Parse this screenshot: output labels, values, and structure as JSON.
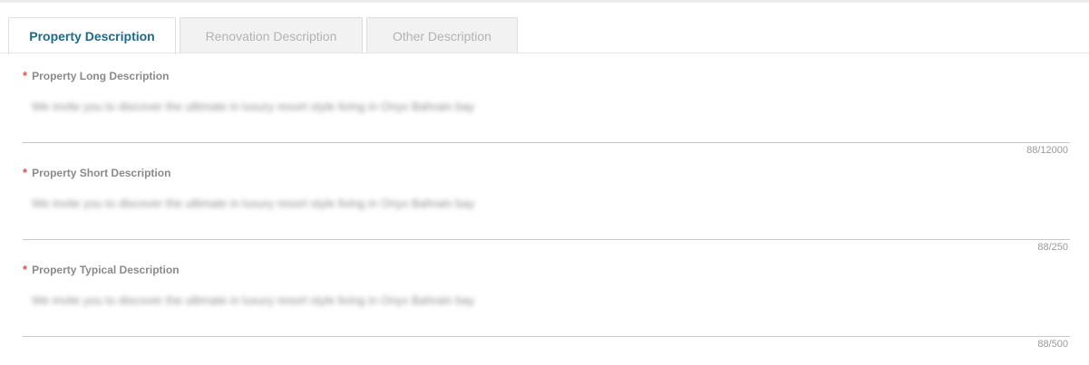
{
  "tabs": [
    {
      "label": "Property Description",
      "active": true
    },
    {
      "label": "Renovation Description",
      "active": false
    },
    {
      "label": "Other Description",
      "active": false
    }
  ],
  "fields": [
    {
      "label": "Property Long Description",
      "required_mark": "*",
      "value": "We invite you to discover the ultimate in luxury resort style living in Onyx Bahrain bay",
      "counter": "88/12000"
    },
    {
      "label": "Property Short Description",
      "required_mark": "*",
      "value": "We invite you to discover the ultimate in luxury resort style living in Onyx Bahrain bay",
      "counter": "88/250"
    },
    {
      "label": "Property Typical Description",
      "required_mark": "*",
      "value": "We invite you to discover the ultimate in luxury resort style living in Onyx Bahrain bay",
      "counter": "88/500"
    }
  ],
  "colors": {
    "active_tab_text": "#1d6a8c",
    "required_mark": "#d9534f"
  }
}
